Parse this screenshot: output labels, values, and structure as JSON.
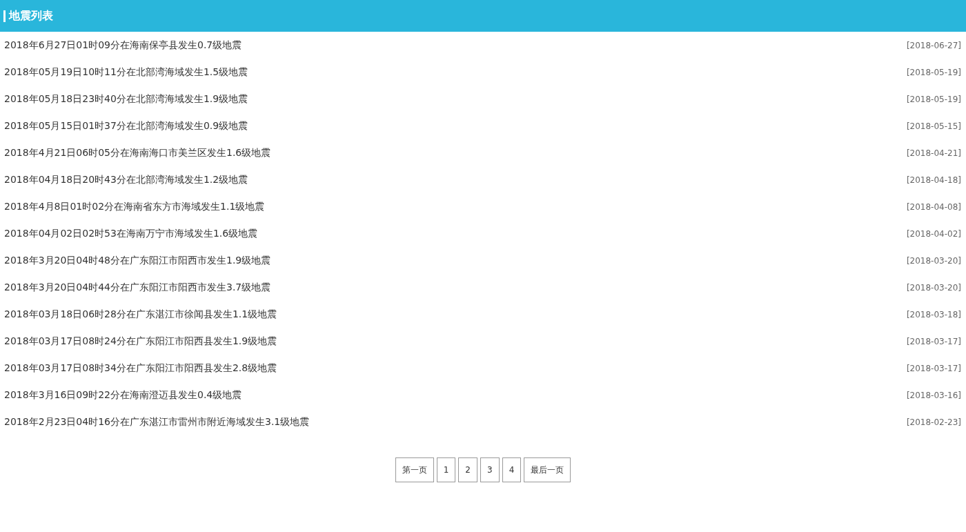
{
  "header": {
    "title": "地震列表"
  },
  "items": [
    {
      "title": "2018年6月27日01时09分在海南保亭县发生0.7级地震",
      "date": "[2018-06-27]"
    },
    {
      "title": "2018年05月19日10时11分在北部湾海域发生1.5级地震",
      "date": "[2018-05-19]"
    },
    {
      "title": "2018年05月18日23时40分在北部湾海域发生1.9级地震",
      "date": "[2018-05-19]"
    },
    {
      "title": "2018年05月15日01时37分在北部湾海域发生0.9级地震",
      "date": "[2018-05-15]"
    },
    {
      "title": "2018年4月21日06时05分在海南海口市美兰区发生1.6级地震",
      "date": "[2018-04-21]"
    },
    {
      "title": "2018年04月18日20时43分在北部湾海域发生1.2级地震",
      "date": "[2018-04-18]"
    },
    {
      "title": "2018年4月8日01时02分在海南省东方市海域发生1.1级地震",
      "date": "[2018-04-08]"
    },
    {
      "title": "2018年04月02日02时53在海南万宁市海域发生1.6级地震",
      "date": "[2018-04-02]"
    },
    {
      "title": "2018年3月20日04时48分在广东阳江市阳西市发生1.9级地震",
      "date": "[2018-03-20]"
    },
    {
      "title": "2018年3月20日04时44分在广东阳江市阳西市发生3.7级地震",
      "date": "[2018-03-20]"
    },
    {
      "title": "2018年03月18日06时28分在广东湛江市徐闻县发生1.1级地震",
      "date": "[2018-03-18]"
    },
    {
      "title": "2018年03月17日08时24分在广东阳江市阳西县发生1.9级地震",
      "date": "[2018-03-17]"
    },
    {
      "title": "2018年03月17日08时34分在广东阳江市阳西县发生2.8级地震",
      "date": "[2018-03-17]"
    },
    {
      "title": "2018年3月16日09时22分在海南澄迈县发生0.4级地震",
      "date": "[2018-03-16]"
    },
    {
      "title": "2018年2月23日04时16分在广东湛江市雷州市附近海域发生3.1级地震",
      "date": "[2018-02-23]"
    }
  ],
  "pagination": [
    "第一页",
    "1",
    "2",
    "3",
    "4",
    "最后一页"
  ]
}
